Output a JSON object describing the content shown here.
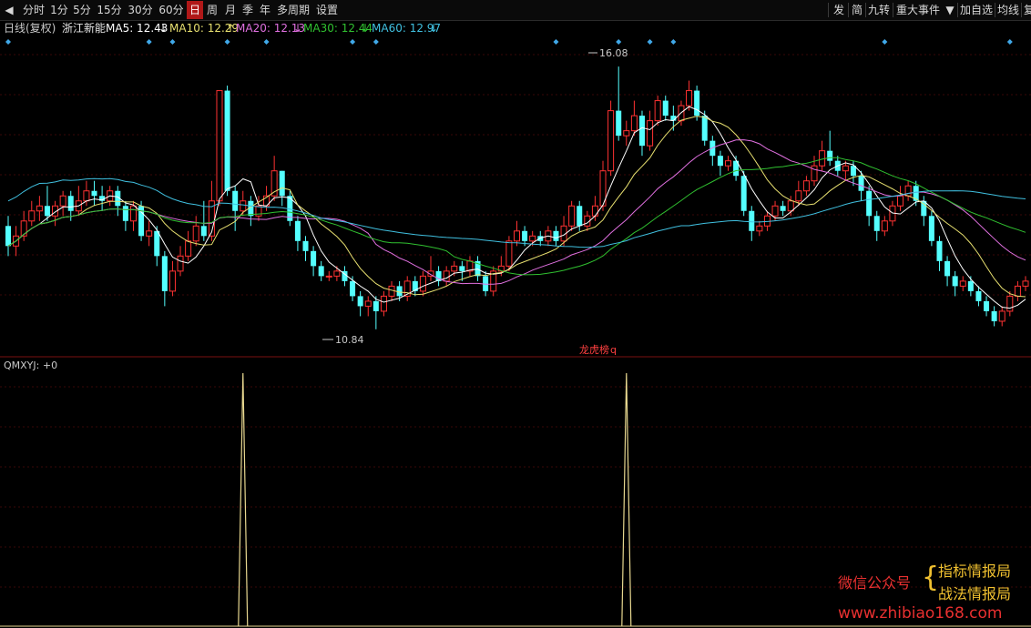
{
  "toolbar": {
    "left_items": [
      "分时",
      "1分",
      "5分",
      "15分",
      "30分",
      "60分",
      "日",
      "周",
      "月",
      "季",
      "年",
      "多周期",
      "设置"
    ],
    "active_index": 6,
    "right_items": [
      "发",
      "简",
      "九转",
      "重大事件",
      "加自选",
      "均线",
      "复"
    ],
    "back_icon": "triangle-left-icon",
    "dropdown_icon": "triangle-down-icon"
  },
  "info_bar": {
    "period": "日线(复权)",
    "stock": "浙江新能",
    "ma": [
      {
        "label": "MA5: 12.43",
        "arrow": "↓",
        "color": "#ffffff"
      },
      {
        "label": "MA10: 12.29",
        "arrow": "↑",
        "color": "#e8e070"
      },
      {
        "label": "MA20: 12.13",
        "arrow": "↓",
        "color": "#e070e0"
      },
      {
        "label": "MA30: 12.44",
        "arrow": "↓",
        "color": "#30c030"
      },
      {
        "label": "MA60: 12.97",
        "arrow": "↓",
        "color": "#40c0e0"
      }
    ]
  },
  "annotations": {
    "high": "16.08",
    "low": "10.84",
    "event1": "龙虎榜",
    "event2": "q"
  },
  "indicator": {
    "label": "QMXYJ: +0"
  },
  "watermark": {
    "left": "微信公众号",
    "right1": "指标情报局",
    "right2": "战法情报局",
    "url": "www.zhibiao168.com"
  },
  "chart_data": [
    {
      "type": "candlestick",
      "title": "",
      "ylim": [
        10.4,
        16.5
      ],
      "colors": {
        "up": "#ff3232",
        "down": "#54ffff"
      },
      "high_label": 16.08,
      "low_label": 10.84,
      "candles": [
        [
          12.9,
          12.5,
          13.1,
          12.3
        ],
        [
          12.5,
          12.7,
          12.9,
          12.3
        ],
        [
          12.7,
          13.0,
          13.2,
          12.6
        ],
        [
          13.0,
          13.2,
          13.4,
          12.9
        ],
        [
          13.2,
          13.3,
          13.5,
          13.0
        ],
        [
          13.3,
          13.1,
          13.7,
          13.0
        ],
        [
          13.1,
          13.3,
          13.4,
          12.9
        ],
        [
          13.3,
          13.5,
          13.6,
          13.1
        ],
        [
          13.5,
          13.2,
          13.6,
          13.0
        ],
        [
          13.2,
          13.4,
          13.7,
          13.1
        ],
        [
          13.4,
          13.6,
          13.8,
          13.3
        ],
        [
          13.6,
          13.5,
          13.8,
          13.3
        ],
        [
          13.5,
          13.4,
          13.7,
          13.2
        ],
        [
          13.4,
          13.6,
          13.7,
          13.3
        ],
        [
          13.6,
          13.3,
          13.7,
          13.1
        ],
        [
          13.3,
          13.0,
          13.4,
          12.8
        ],
        [
          13.0,
          13.3,
          13.4,
          12.8
        ],
        [
          13.3,
          12.7,
          13.4,
          12.6
        ],
        [
          12.7,
          12.8,
          13.0,
          12.5
        ],
        [
          12.8,
          12.3,
          12.9,
          12.1
        ],
        [
          12.3,
          11.6,
          12.4,
          11.3
        ],
        [
          11.6,
          12.0,
          12.2,
          11.5
        ],
        [
          12.0,
          12.3,
          12.5,
          11.9
        ],
        [
          12.3,
          12.6,
          12.8,
          12.2
        ],
        [
          12.6,
          12.9,
          13.1,
          12.5
        ],
        [
          12.9,
          12.7,
          13.4,
          12.6
        ],
        [
          12.7,
          13.4,
          13.8,
          12.6
        ],
        [
          13.4,
          15.6,
          15.6,
          13.3
        ],
        [
          15.6,
          13.6,
          15.7,
          13.5
        ],
        [
          13.6,
          13.2,
          13.7,
          12.8
        ],
        [
          13.2,
          13.4,
          13.6,
          13.1
        ],
        [
          13.4,
          13.1,
          13.5,
          12.9
        ],
        [
          13.1,
          13.3,
          13.5,
          13.0
        ],
        [
          13.3,
          13.5,
          13.7,
          13.2
        ],
        [
          13.5,
          14.0,
          14.3,
          13.4
        ],
        [
          14.0,
          13.5,
          14.0,
          13.3
        ],
        [
          13.5,
          13.0,
          13.6,
          12.9
        ],
        [
          13.0,
          12.6,
          13.1,
          12.4
        ],
        [
          12.6,
          12.4,
          12.7,
          12.2
        ],
        [
          12.4,
          12.1,
          12.5,
          11.9
        ],
        [
          12.1,
          11.9,
          12.2,
          11.8
        ],
        [
          11.9,
          11.9,
          12.0,
          11.8
        ],
        [
          11.9,
          12.0,
          12.1,
          11.8
        ],
        [
          12.0,
          11.8,
          12.1,
          11.7
        ],
        [
          11.8,
          11.5,
          11.9,
          11.4
        ],
        [
          11.5,
          11.3,
          11.6,
          11.1
        ],
        [
          11.3,
          11.4,
          11.5,
          11.1
        ],
        [
          11.4,
          11.2,
          11.5,
          10.84
        ],
        [
          11.2,
          11.5,
          11.6,
          11.1
        ],
        [
          11.5,
          11.7,
          11.8,
          11.4
        ],
        [
          11.7,
          11.5,
          11.8,
          11.4
        ],
        [
          11.5,
          11.8,
          11.9,
          11.4
        ],
        [
          11.8,
          11.6,
          11.9,
          11.5
        ],
        [
          11.6,
          11.9,
          12.0,
          11.5
        ],
        [
          11.9,
          12.0,
          12.3,
          11.8
        ],
        [
          12.0,
          11.8,
          12.1,
          11.7
        ],
        [
          11.8,
          12.0,
          12.1,
          11.7
        ],
        [
          12.0,
          12.1,
          12.2,
          11.9
        ],
        [
          12.1,
          12.0,
          12.2,
          11.8
        ],
        [
          12.0,
          12.2,
          12.3,
          11.9
        ],
        [
          12.2,
          11.9,
          12.3,
          11.8
        ],
        [
          11.9,
          11.6,
          12.0,
          11.5
        ],
        [
          11.6,
          12.0,
          12.1,
          11.5
        ],
        [
          12.0,
          12.1,
          12.3,
          11.9
        ],
        [
          12.1,
          12.6,
          12.7,
          12.0
        ],
        [
          12.6,
          12.8,
          13.0,
          12.5
        ],
        [
          12.8,
          12.6,
          12.9,
          12.5
        ],
        [
          12.6,
          12.7,
          12.8,
          12.5
        ],
        [
          12.7,
          12.6,
          12.8,
          12.5
        ],
        [
          12.6,
          12.8,
          12.9,
          12.5
        ],
        [
          12.8,
          12.6,
          12.9,
          12.5
        ],
        [
          12.6,
          12.9,
          13.1,
          12.5
        ],
        [
          12.9,
          13.3,
          13.4,
          12.8
        ],
        [
          13.3,
          12.9,
          13.4,
          12.8
        ],
        [
          12.9,
          13.1,
          13.2,
          12.8
        ],
        [
          13.1,
          13.3,
          13.5,
          13.0
        ],
        [
          13.3,
          14.0,
          14.2,
          13.2
        ],
        [
          14.0,
          15.2,
          15.4,
          13.9
        ],
        [
          15.2,
          14.7,
          16.08,
          14.6
        ],
        [
          14.7,
          14.8,
          15.0,
          14.5
        ],
        [
          14.8,
          15.1,
          15.4,
          14.7
        ],
        [
          15.1,
          14.5,
          15.2,
          14.3
        ],
        [
          14.5,
          15.0,
          15.2,
          14.4
        ],
        [
          15.0,
          15.4,
          15.5,
          14.9
        ],
        [
          15.4,
          15.1,
          15.5,
          15.0
        ],
        [
          15.1,
          15.0,
          15.3,
          14.8
        ],
        [
          15.0,
          15.3,
          15.4,
          14.9
        ],
        [
          15.3,
          15.6,
          15.8,
          15.2
        ],
        [
          15.6,
          15.1,
          15.7,
          15.0
        ],
        [
          15.1,
          14.6,
          15.2,
          14.5
        ],
        [
          14.6,
          14.3,
          14.7,
          14.1
        ],
        [
          14.3,
          14.1,
          14.4,
          13.9
        ],
        [
          14.1,
          14.2,
          14.3,
          14.0
        ],
        [
          14.2,
          13.9,
          14.3,
          13.8
        ],
        [
          13.9,
          13.2,
          14.0,
          13.1
        ],
        [
          13.2,
          12.8,
          13.3,
          12.6
        ],
        [
          12.8,
          12.9,
          13.0,
          12.7
        ],
        [
          12.9,
          13.1,
          13.2,
          12.8
        ],
        [
          13.1,
          13.3,
          13.4,
          13.0
        ],
        [
          13.3,
          13.2,
          13.4,
          13.1
        ],
        [
          13.2,
          13.4,
          13.5,
          13.1
        ],
        [
          13.4,
          13.6,
          13.8,
          13.3
        ],
        [
          13.6,
          13.8,
          13.9,
          13.5
        ],
        [
          13.8,
          14.1,
          14.3,
          13.7
        ],
        [
          14.1,
          14.4,
          14.6,
          14.0
        ],
        [
          14.4,
          14.2,
          14.8,
          14.1
        ],
        [
          14.2,
          14.0,
          14.3,
          13.9
        ],
        [
          14.0,
          14.1,
          14.2,
          13.8
        ],
        [
          14.1,
          13.9,
          14.2,
          13.7
        ],
        [
          13.9,
          13.6,
          14.0,
          13.4
        ],
        [
          13.6,
          13.1,
          13.7,
          12.9
        ],
        [
          13.1,
          12.8,
          13.2,
          12.6
        ],
        [
          12.8,
          13.0,
          13.1,
          12.7
        ],
        [
          13.0,
          13.3,
          13.4,
          12.9
        ],
        [
          13.3,
          13.5,
          13.7,
          13.2
        ],
        [
          13.5,
          13.7,
          13.8,
          13.4
        ],
        [
          13.7,
          13.4,
          13.8,
          13.3
        ],
        [
          13.4,
          13.1,
          13.5,
          12.9
        ],
        [
          13.1,
          12.6,
          13.2,
          12.5
        ],
        [
          12.6,
          12.2,
          12.7,
          12.0
        ],
        [
          12.2,
          11.9,
          12.3,
          11.7
        ],
        [
          11.9,
          11.7,
          12.0,
          11.5
        ],
        [
          11.7,
          11.8,
          11.9,
          11.6
        ],
        [
          11.8,
          11.6,
          11.9,
          11.5
        ],
        [
          11.6,
          11.4,
          11.7,
          11.3
        ],
        [
          11.4,
          11.2,
          11.5,
          11.1
        ],
        [
          11.2,
          11.0,
          11.3,
          10.9
        ],
        [
          11.0,
          11.2,
          11.3,
          10.9
        ],
        [
          11.2,
          11.5,
          11.6,
          11.1
        ],
        [
          11.5,
          11.7,
          11.8,
          11.4
        ],
        [
          11.7,
          11.8,
          11.9,
          11.6
        ]
      ],
      "event_markers": [
        0,
        18,
        21,
        28,
        33,
        44,
        47,
        70,
        78,
        82,
        85,
        112,
        128
      ]
    },
    {
      "type": "line",
      "title": "",
      "name": "QMXYJ",
      "ylim": [
        0,
        1
      ],
      "spikes": [
        30,
        79
      ],
      "values_note_visible": "+0"
    }
  ]
}
